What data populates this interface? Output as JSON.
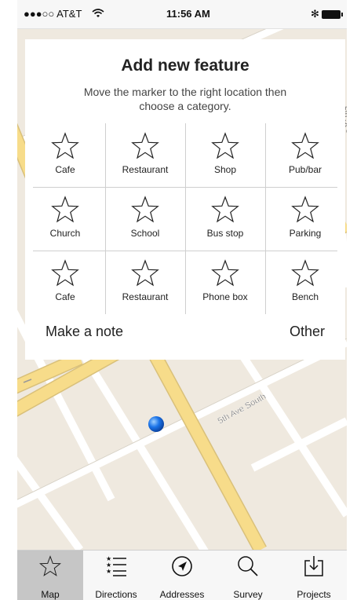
{
  "status_bar": {
    "carrier": "●●●○○ AT&T",
    "time": "11:56 AM"
  },
  "map": {
    "street_label": "5th Ave South",
    "street_label_2": "5th St S"
  },
  "panel": {
    "title": "Add new feature",
    "subtitle": "Move the marker to the right location then choose a category.",
    "categories": [
      {
        "label": "Cafe",
        "icon": "star-icon"
      },
      {
        "label": "Restaurant",
        "icon": "star-icon"
      },
      {
        "label": "Shop",
        "icon": "star-icon"
      },
      {
        "label": "Pub/bar",
        "icon": "star-icon"
      },
      {
        "label": "Church",
        "icon": "star-icon"
      },
      {
        "label": "School",
        "icon": "star-icon"
      },
      {
        "label": "Bus stop",
        "icon": "star-icon"
      },
      {
        "label": "Parking",
        "icon": "star-icon"
      },
      {
        "label": "Cafe",
        "icon": "star-icon"
      },
      {
        "label": "Restaurant",
        "icon": "star-icon"
      },
      {
        "label": "Phone box",
        "icon": "star-icon"
      },
      {
        "label": "Bench",
        "icon": "star-icon"
      }
    ],
    "make_note_label": "Make a note",
    "other_label": "Other"
  },
  "tabbar": {
    "selected": "Map",
    "tabs": [
      {
        "label": "Map",
        "icon": "star-icon"
      },
      {
        "label": "Directions",
        "icon": "list-icon"
      },
      {
        "label": "Addresses",
        "icon": "compass-icon"
      },
      {
        "label": "Survey",
        "icon": "search-icon"
      },
      {
        "label": "Projects",
        "icon": "download-icon"
      }
    ]
  },
  "colors": {
    "map_background": "#efe9df",
    "major_road": "#f7dc8a",
    "minor_road": "#ffffff",
    "marker": "#1a73e8",
    "selected_tab": "#c6c6c6"
  }
}
